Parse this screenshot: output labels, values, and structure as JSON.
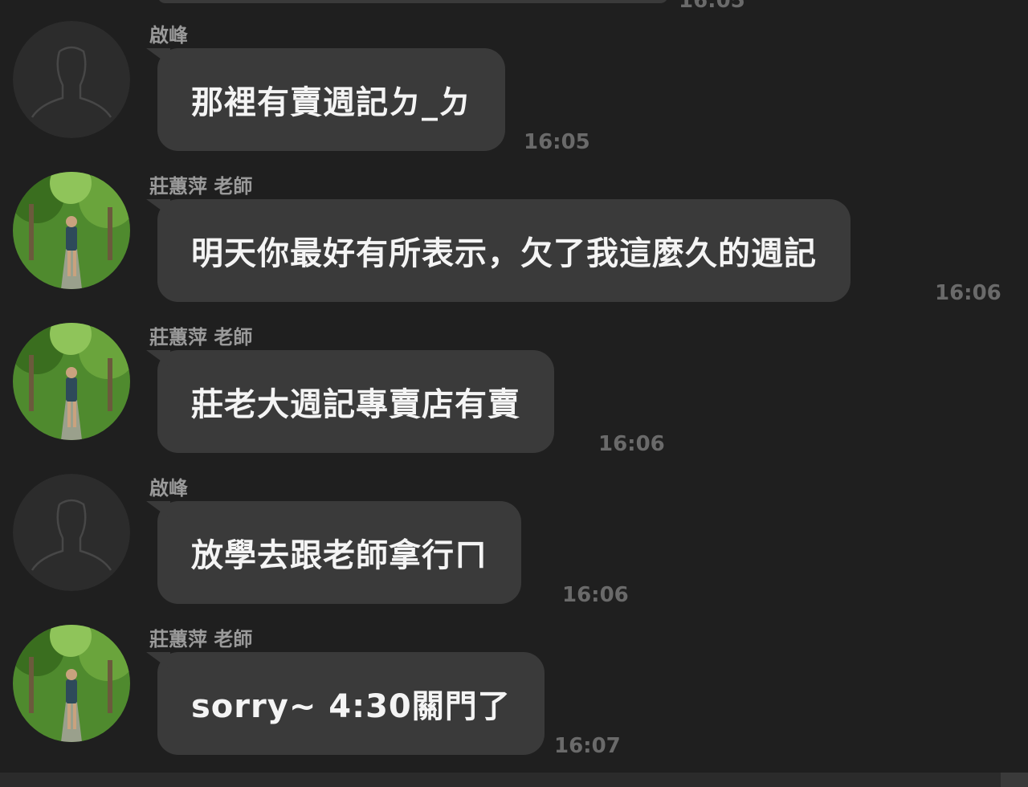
{
  "top": {
    "time": "16:05"
  },
  "messages": [
    {
      "sender": "啟峰",
      "avatar": "default-person-icon",
      "text": "那裡有賣週記ㄉ_ㄉ",
      "time": "16:05"
    },
    {
      "sender": "莊蕙萍 老師",
      "avatar": "photo-avatar",
      "text": "明天你最好有所表示，欠了我這麼久的週記",
      "time": "16:06"
    },
    {
      "sender": "莊蕙萍 老師",
      "avatar": "photo-avatar",
      "text": "莊老大週記專賣店有賣",
      "time": "16:06"
    },
    {
      "sender": "啟峰",
      "avatar": "default-person-icon",
      "text": "放學去跟老師拿行ㄇ",
      "time": "16:06"
    },
    {
      "sender": "莊蕙萍 老師",
      "avatar": "photo-avatar",
      "text": "sorry~ 4:30關門了",
      "time": "16:07"
    }
  ],
  "colors": {
    "background": "#1f1f1f",
    "bubble": "#3a3a3a",
    "text": "#f4f4f4",
    "sender": "#9a9a9a",
    "time": "#6a6a6a"
  }
}
